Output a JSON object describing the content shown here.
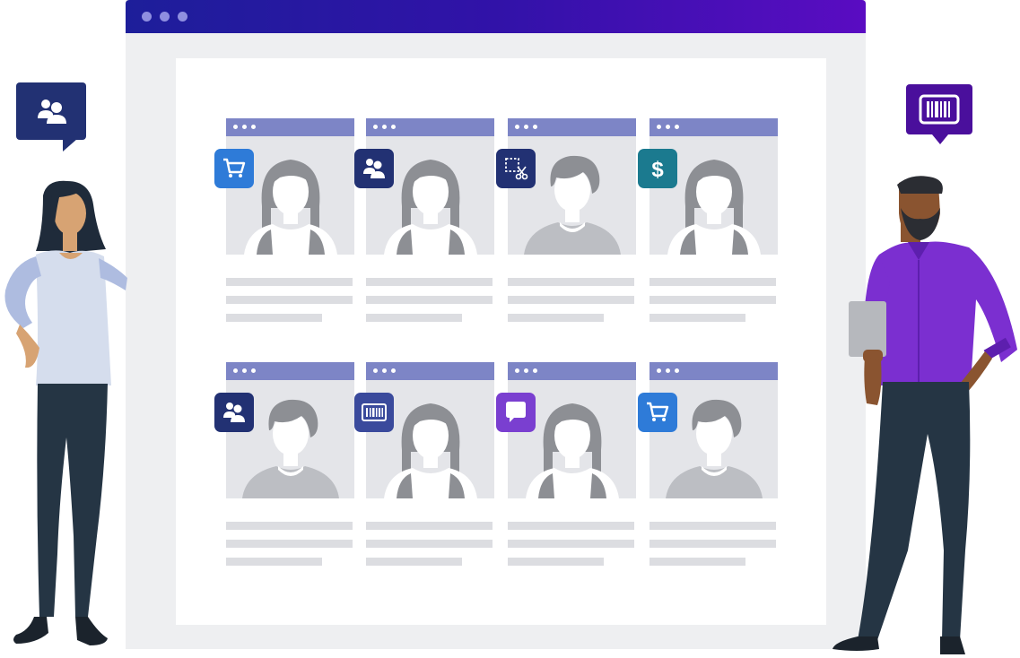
{
  "colors": {
    "window_bar_start": "#1d1e9a",
    "window_bar_end": "#5a0cc2",
    "card_header": "#7d85c6",
    "badge_blue": "#2e7bd8",
    "badge_navy": "#223173",
    "badge_teal": "#1b7a8f",
    "badge_indigo": "#3a4a9c",
    "badge_purple": "#7a3fd0",
    "shirt_purple": "#7b2fd0"
  },
  "left_bubble": {
    "icon": "people-icon"
  },
  "right_bubble": {
    "icon": "barcode-icon"
  },
  "cards": [
    {
      "badge": "cart-icon",
      "avatar": "female"
    },
    {
      "badge": "people-icon",
      "avatar": "female"
    },
    {
      "badge": "scissors-select-icon",
      "avatar": "male"
    },
    {
      "badge": "dollar-icon",
      "avatar": "female"
    },
    {
      "badge": "people-icon",
      "avatar": "male"
    },
    {
      "badge": "barcode-icon",
      "avatar": "female"
    },
    {
      "badge": "chat-icon",
      "avatar": "female"
    },
    {
      "badge": "cart-icon",
      "avatar": "male"
    }
  ]
}
